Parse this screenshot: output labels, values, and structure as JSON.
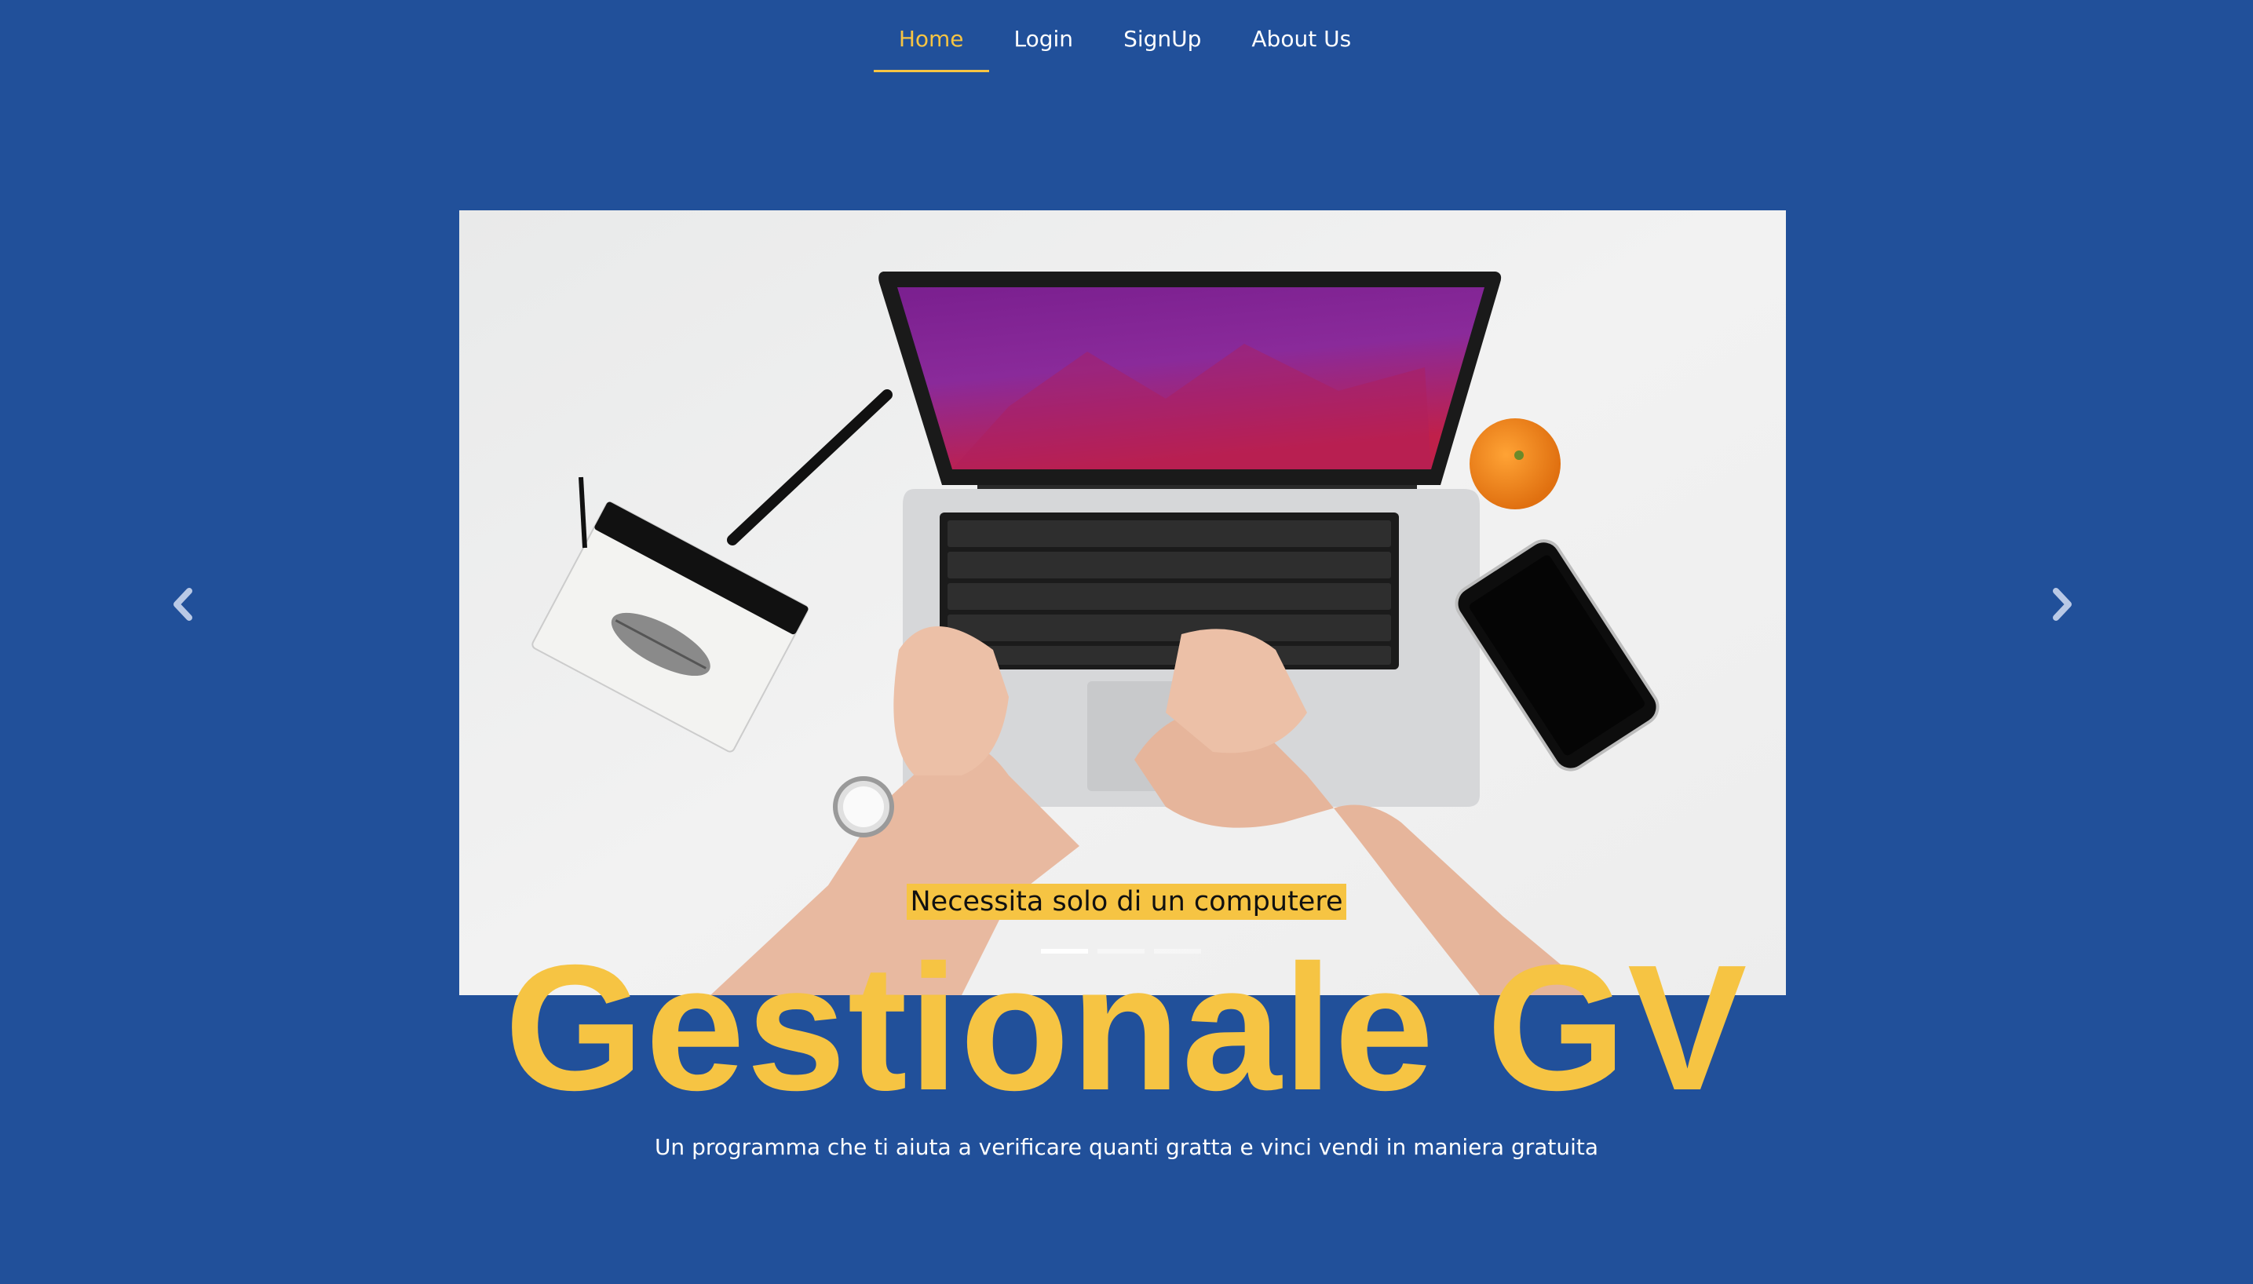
{
  "nav": {
    "items": [
      {
        "label": "Home",
        "active": true
      },
      {
        "label": "Login",
        "active": false
      },
      {
        "label": "SignUp",
        "active": false
      },
      {
        "label": "About Us",
        "active": false
      }
    ]
  },
  "carousel": {
    "caption": "Necessita solo di un computere",
    "slide_count": 3,
    "active_slide": 1,
    "prev_icon": "chevron-left-icon",
    "next_icon": "chevron-right-icon"
  },
  "hero": {
    "title": "Gestionale GV",
    "subtitle": "Un programma che ti aiuta a verificare quanti gratta e vinci vendi in maniera gratuita"
  },
  "colors": {
    "background": "#21509a",
    "accent": "#f6c443",
    "text": "#ffffff"
  }
}
